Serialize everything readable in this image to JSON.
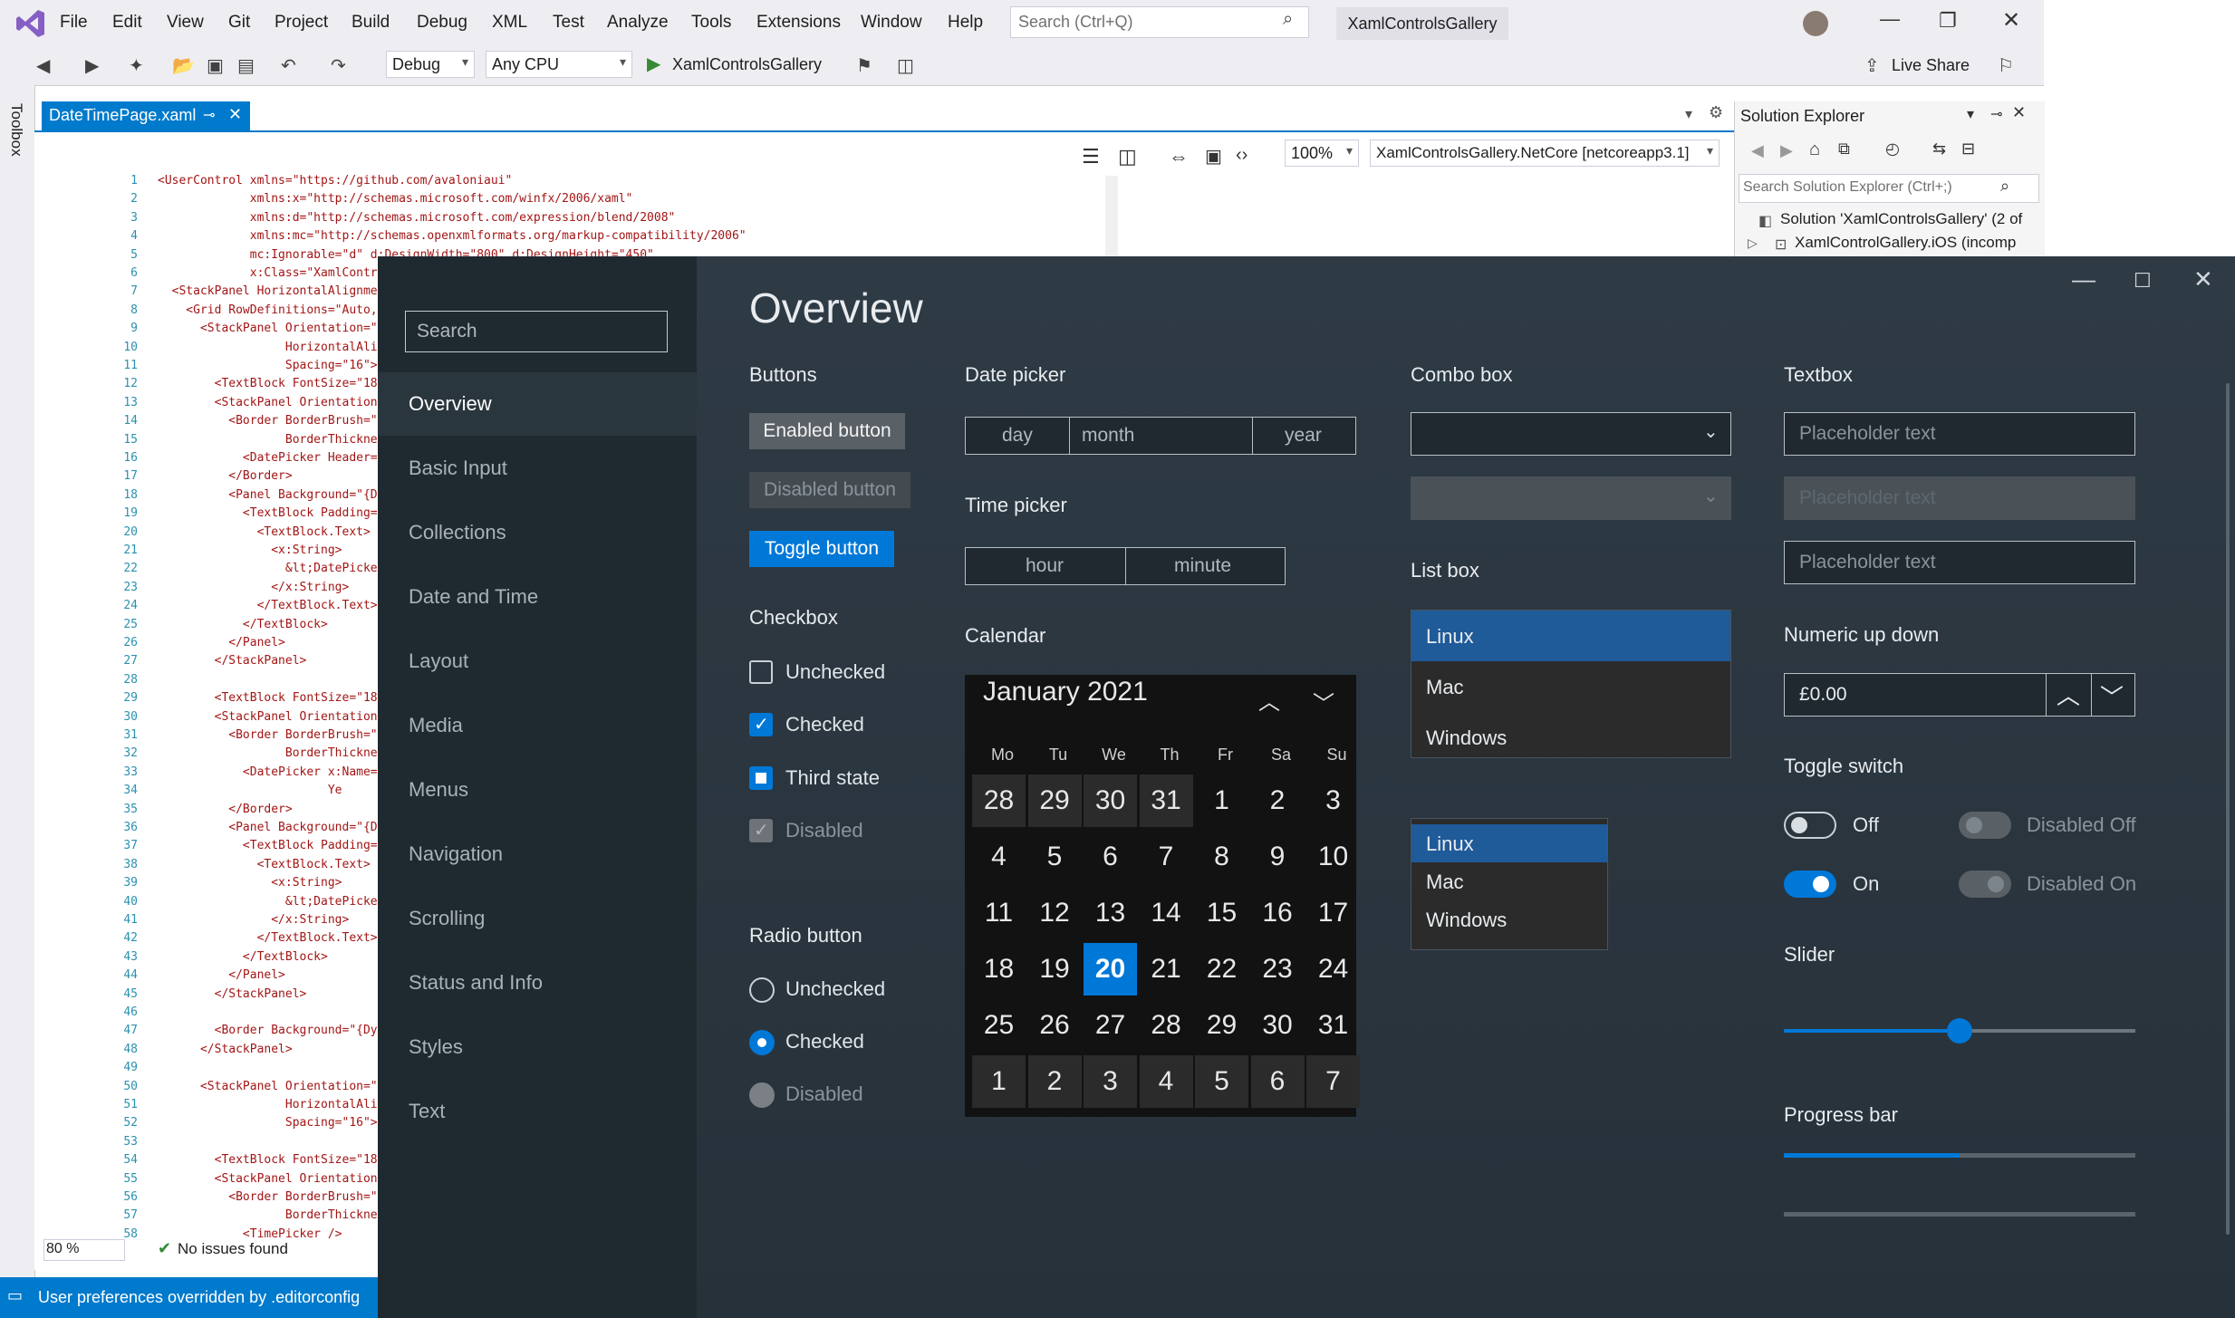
{
  "vs": {
    "menu": [
      "File",
      "Edit",
      "View",
      "Git",
      "Project",
      "Build",
      "Debug",
      "XML",
      "Test",
      "Analyze",
      "Tools",
      "Extensions",
      "Window",
      "Help"
    ],
    "search_placeholder": "Search (Ctrl+Q)",
    "solution_title": "XamlControlsGallery",
    "live_share": "Live Share",
    "config": "Debug",
    "platform": "Any CPU",
    "run_target": "XamlControlsGallery",
    "toolbox_label": "Toolbox",
    "doc_tab": "DateTimePage.xaml",
    "zoom_designer": "100%",
    "target_framework": "XamlControlsGallery.NetCore [netcoreapp3.1]",
    "zoom_editor": "80 %",
    "issues": "No issues found",
    "status_message": "User preferences overridden by .editorconfig",
    "solution_explorer": {
      "title": "Solution Explorer",
      "search_placeholder": "Search Solution Explorer (Ctrl+;)",
      "items": [
        "Solution 'XamlControlsGallery' (2 of",
        "XamlControlGallery.iOS (incomp"
      ]
    },
    "code_lines": [
      {
        "n": "1",
        "t": "<UserControl xmlns=\"https://github.com/avaloniaui\""
      },
      {
        "n": "2",
        "t": "             xmlns:x=\"http://schemas.microsoft.com/winfx/2006/xaml\""
      },
      {
        "n": "3",
        "t": "             xmlns:d=\"http://schemas.microsoft.com/expression/blend/2008\""
      },
      {
        "n": "4",
        "t": "             xmlns:mc=\"http://schemas.openxmlformats.org/markup-compatibility/2006\""
      },
      {
        "n": "5",
        "t": "             mc:Ignorable=\"d\" d:DesignWidth=\"800\" d:DesignHeight=\"450\""
      },
      {
        "n": "6",
        "t": "             x:Class=\"XamlControl"
      },
      {
        "n": "7",
        "t": "  <StackPanel HorizontalAlignment"
      },
      {
        "n": "8",
        "t": "    <Grid RowDefinitions=\"Auto, A"
      },
      {
        "n": "9",
        "t": "      <StackPanel Orientation=\"Ve"
      },
      {
        "n": "10",
        "t": "                  HorizontalAlignme"
      },
      {
        "n": "11",
        "t": "                  Spacing=\"16\">"
      },
      {
        "n": "12",
        "t": "        <TextBlock FontSize=\"18\">"
      },
      {
        "n": "13",
        "t": "        <StackPanel Orientation=\""
      },
      {
        "n": "14",
        "t": "          <Border BorderBrush=\"{D"
      },
      {
        "n": "15",
        "t": "                  BorderThickness"
      },
      {
        "n": "16",
        "t": "            <DatePicker Header=\""
      },
      {
        "n": "17",
        "t": "          </Border>"
      },
      {
        "n": "18",
        "t": "          <Panel Background=\"{Dyn"
      },
      {
        "n": "19",
        "t": "            <TextBlock Padding=\"1"
      },
      {
        "n": "20",
        "t": "              <TextBlock.Text>"
      },
      {
        "n": "21",
        "t": "                <x:String>"
      },
      {
        "n": "22",
        "t": "                  &lt;DatePicker"
      },
      {
        "n": "23",
        "t": "                </x:String>"
      },
      {
        "n": "24",
        "t": "              </TextBlock.Text>"
      },
      {
        "n": "25",
        "t": "            </TextBlock>"
      },
      {
        "n": "26",
        "t": "          </Panel>"
      },
      {
        "n": "27",
        "t": "        </StackPanel>"
      },
      {
        "n": "28",
        "t": ""
      },
      {
        "n": "29",
        "t": "        <TextBlock FontSize=\"18\">"
      },
      {
        "n": "30",
        "t": "        <StackPanel Orientation=\""
      },
      {
        "n": "31",
        "t": "          <Border BorderBrush=\"{D"
      },
      {
        "n": "32",
        "t": "                  BorderThickness"
      },
      {
        "n": "33",
        "t": "            <DatePicker x:Name=\"C"
      },
      {
        "n": "34",
        "t": "                        Ye"
      },
      {
        "n": "35",
        "t": "          </Border>"
      },
      {
        "n": "36",
        "t": "          <Panel Background=\"{Dyn"
      },
      {
        "n": "37",
        "t": "            <TextBlock Padding=\"1"
      },
      {
        "n": "38",
        "t": "              <TextBlock.Text>"
      },
      {
        "n": "39",
        "t": "                <x:String>"
      },
      {
        "n": "40",
        "t": "                  &lt;DatePicker"
      },
      {
        "n": "41",
        "t": "                </x:String>"
      },
      {
        "n": "42",
        "t": "              </TextBlock.Text>"
      },
      {
        "n": "43",
        "t": "            </TextBlock>"
      },
      {
        "n": "44",
        "t": "          </Panel>"
      },
      {
        "n": "45",
        "t": "        </StackPanel>"
      },
      {
        "n": "46",
        "t": ""
      },
      {
        "n": "47",
        "t": "        <Border Background=\"{Dyna"
      },
      {
        "n": "48",
        "t": "      </StackPanel>"
      },
      {
        "n": "49",
        "t": ""
      },
      {
        "n": "50",
        "t": "      <StackPanel Orientation=\"Ve"
      },
      {
        "n": "51",
        "t": "                  HorizontalAlignme"
      },
      {
        "n": "52",
        "t": "                  Spacing=\"16\">"
      },
      {
        "n": "53",
        "t": ""
      },
      {
        "n": "54",
        "t": "        <TextBlock FontSize=\"18\">"
      },
      {
        "n": "55",
        "t": "        <StackPanel Orientation=\""
      },
      {
        "n": "56",
        "t": "          <Border BorderBrush=\"{D"
      },
      {
        "n": "57",
        "t": "                  BorderThickness"
      },
      {
        "n": "58",
        "t": "            <TimePicker />"
      }
    ]
  },
  "app": {
    "search_placeholder": "Search",
    "nav": [
      "Overview",
      "Basic Input",
      "Collections",
      "Date and Time",
      "Layout",
      "Media",
      "Menus",
      "Navigation",
      "Scrolling",
      "Status and Info",
      "Styles",
      "Text"
    ],
    "selected_nav": "Overview",
    "title": "Overview",
    "buttons": {
      "header": "Buttons",
      "enabled": "Enabled button",
      "disabled": "Disabled button",
      "toggle": "Toggle button"
    },
    "checkbox": {
      "header": "Checkbox",
      "unchecked": "Unchecked",
      "checked": "Checked",
      "third": "Third state",
      "disabled": "Disabled"
    },
    "radio": {
      "header": "Radio button",
      "unchecked": "Unchecked",
      "checked": "Checked",
      "disabled": "Disabled"
    },
    "datepicker": {
      "header": "Date picker",
      "day": "day",
      "month": "month",
      "year": "year"
    },
    "timepicker": {
      "header": "Time picker",
      "hour": "hour",
      "minute": "minute"
    },
    "calendar": {
      "header": "Calendar",
      "month": "January 2021",
      "weekdays": [
        "Mo",
        "Tu",
        "We",
        "Th",
        "Fr",
        "Sa",
        "Su"
      ],
      "days": [
        "28",
        "29",
        "30",
        "31",
        "1",
        "2",
        "3",
        "4",
        "5",
        "6",
        "7",
        "8",
        "9",
        "10",
        "11",
        "12",
        "13",
        "14",
        "15",
        "16",
        "17",
        "18",
        "19",
        "20",
        "21",
        "22",
        "23",
        "24",
        "25",
        "26",
        "27",
        "28",
        "29",
        "30",
        "31",
        "1",
        "2",
        "3",
        "4",
        "5",
        "6",
        "7"
      ],
      "selected": "20"
    },
    "combobox": {
      "header": "Combo box"
    },
    "listbox": {
      "header": "List box",
      "items": [
        "Linux",
        "Mac",
        "Windows"
      ],
      "selected": "Linux"
    },
    "textbox": {
      "header": "Textbox",
      "placeholder": "Placeholder text"
    },
    "numeric": {
      "header": "Numeric up down",
      "value": "£0.00"
    },
    "toggle": {
      "header": "Toggle switch",
      "off": "Off",
      "on": "On",
      "disabled_off": "Disabled Off",
      "disabled_on": "Disabled On"
    },
    "slider": {
      "header": "Slider",
      "value": 0.5
    },
    "progress": {
      "header": "Progress bar",
      "value": 0.5
    },
    "colors": {
      "accent": "#0078d7",
      "selected_list": "#1f5a99",
      "vs_blue": "#007acc"
    }
  }
}
